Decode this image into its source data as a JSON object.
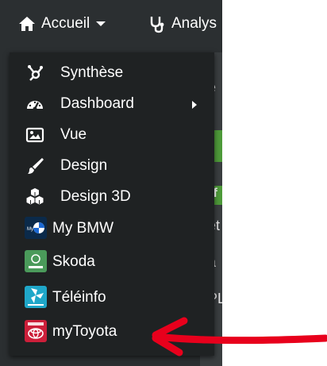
{
  "navbar": {
    "accueil_label": "Accueil",
    "analysis_label": "Analys"
  },
  "background": {
    "snippets": [
      "e",
      "if",
      "et",
      "a",
      "PL"
    ]
  },
  "menu": {
    "items": [
      {
        "label": "Synthèse",
        "icon": "hub-icon"
      },
      {
        "label": "Dashboard",
        "icon": "gauge-icon",
        "has_submenu": true
      },
      {
        "label": "Vue",
        "icon": "image-icon"
      },
      {
        "label": "Design",
        "icon": "paintbrush-icon"
      },
      {
        "label": "Design 3D",
        "icon": "cubes-icon"
      },
      {
        "label": "My BMW",
        "icon": "mybmw-app-icon"
      },
      {
        "label": "Skoda",
        "icon": "skoda-app-icon"
      },
      {
        "label": "Téléinfo",
        "icon": "teleinfo-app-icon"
      },
      {
        "label": "myToyota",
        "icon": "mytoyota-app-icon"
      }
    ]
  },
  "colors": {
    "navbar_bg": "#2b2f31",
    "dropdown_bg": "#1f2223",
    "text": "#ffffff",
    "accent_green": "#4e9a3a",
    "annotation_arrow": "#e8001c",
    "mybmw_icon_bg": "#0b2a4a",
    "skoda_icon_bg": "#4a9a5a",
    "teleinfo_icon_bg": "#1fa7c9",
    "mytoyota_icon_bg": "#cc1f3a"
  }
}
